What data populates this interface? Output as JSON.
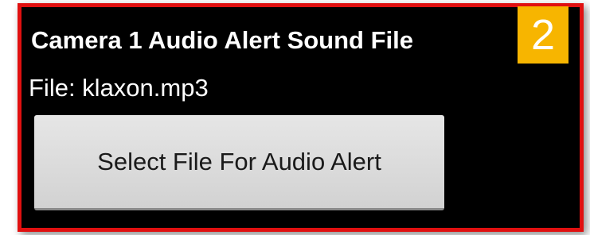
{
  "setting": {
    "title": "Camera 1 Audio Alert Sound File",
    "file_text": "File: klaxon.mp3",
    "button_label": "Select File For Audio Alert"
  },
  "annotation": {
    "step_number": "2",
    "badge_color": "#f7b500",
    "highlight_color": "#e01010"
  }
}
